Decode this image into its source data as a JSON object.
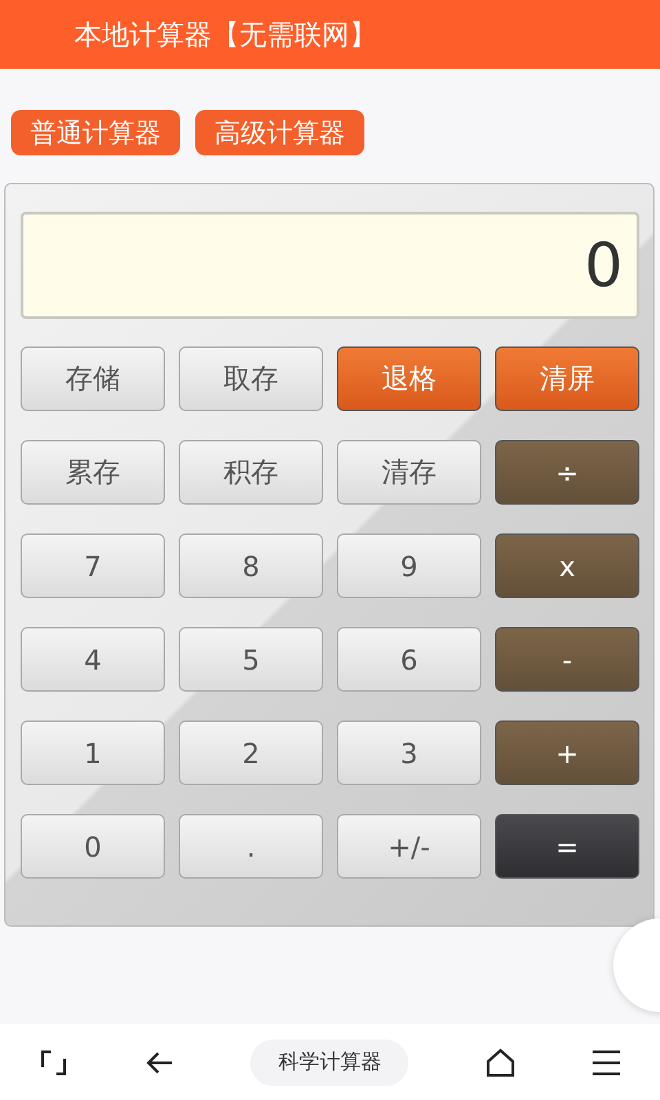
{
  "header": {
    "title": "本地计算器【无需联网】"
  },
  "modes": [
    "普通计算器",
    "高级计算器"
  ],
  "display": {
    "value": "0"
  },
  "keys": [
    {
      "label": "存储",
      "kind": "gray"
    },
    {
      "label": "取存",
      "kind": "gray"
    },
    {
      "label": "退格",
      "kind": "orange"
    },
    {
      "label": "清屏",
      "kind": "orange"
    },
    {
      "label": "累存",
      "kind": "gray"
    },
    {
      "label": "积存",
      "kind": "gray"
    },
    {
      "label": "清存",
      "kind": "gray"
    },
    {
      "label": "÷",
      "kind": "brown"
    },
    {
      "label": "7",
      "kind": "gray"
    },
    {
      "label": "8",
      "kind": "gray"
    },
    {
      "label": "9",
      "kind": "gray"
    },
    {
      "label": "x",
      "kind": "brown"
    },
    {
      "label": "4",
      "kind": "gray"
    },
    {
      "label": "5",
      "kind": "gray"
    },
    {
      "label": "6",
      "kind": "gray"
    },
    {
      "label": "-",
      "kind": "brown"
    },
    {
      "label": "1",
      "kind": "gray"
    },
    {
      "label": "2",
      "kind": "gray"
    },
    {
      "label": "3",
      "kind": "gray"
    },
    {
      "label": "+",
      "kind": "brown"
    },
    {
      "label": "0",
      "kind": "gray"
    },
    {
      "label": ".",
      "kind": "gray"
    },
    {
      "label": "+/-",
      "kind": "gray"
    },
    {
      "label": "=",
      "kind": "dark"
    }
  ],
  "bottom_bar": {
    "center_label": "科学计算器"
  }
}
